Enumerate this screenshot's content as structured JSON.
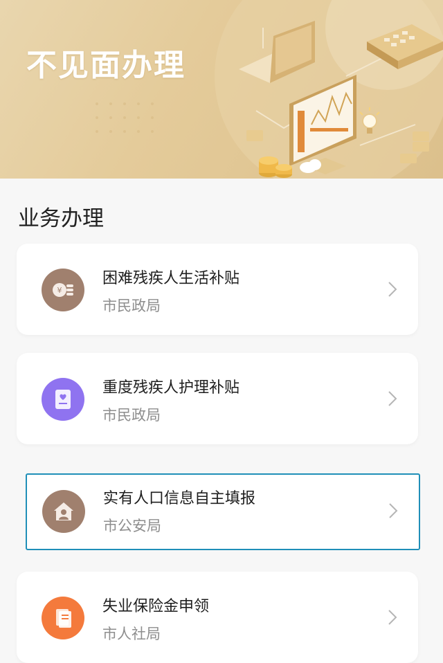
{
  "banner": {
    "title": "不见面办理"
  },
  "section": {
    "title": "业务办理"
  },
  "services": [
    {
      "title": "困难残疾人生活补贴",
      "department": "市民政局",
      "icon": "yuan-coins-icon",
      "color": "#9c7a6a"
    },
    {
      "title": "重度残疾人护理补贴",
      "department": "市民政局",
      "icon": "document-heart-icon",
      "color": "#8b6df0"
    },
    {
      "title": "实有人口信息自主填报",
      "department": "市公安局",
      "icon": "house-person-icon",
      "color": "#9c7a6a"
    },
    {
      "title": "失业保险金申领",
      "department": "市人社局",
      "icon": "book-icon",
      "color": "#f2783a"
    }
  ]
}
